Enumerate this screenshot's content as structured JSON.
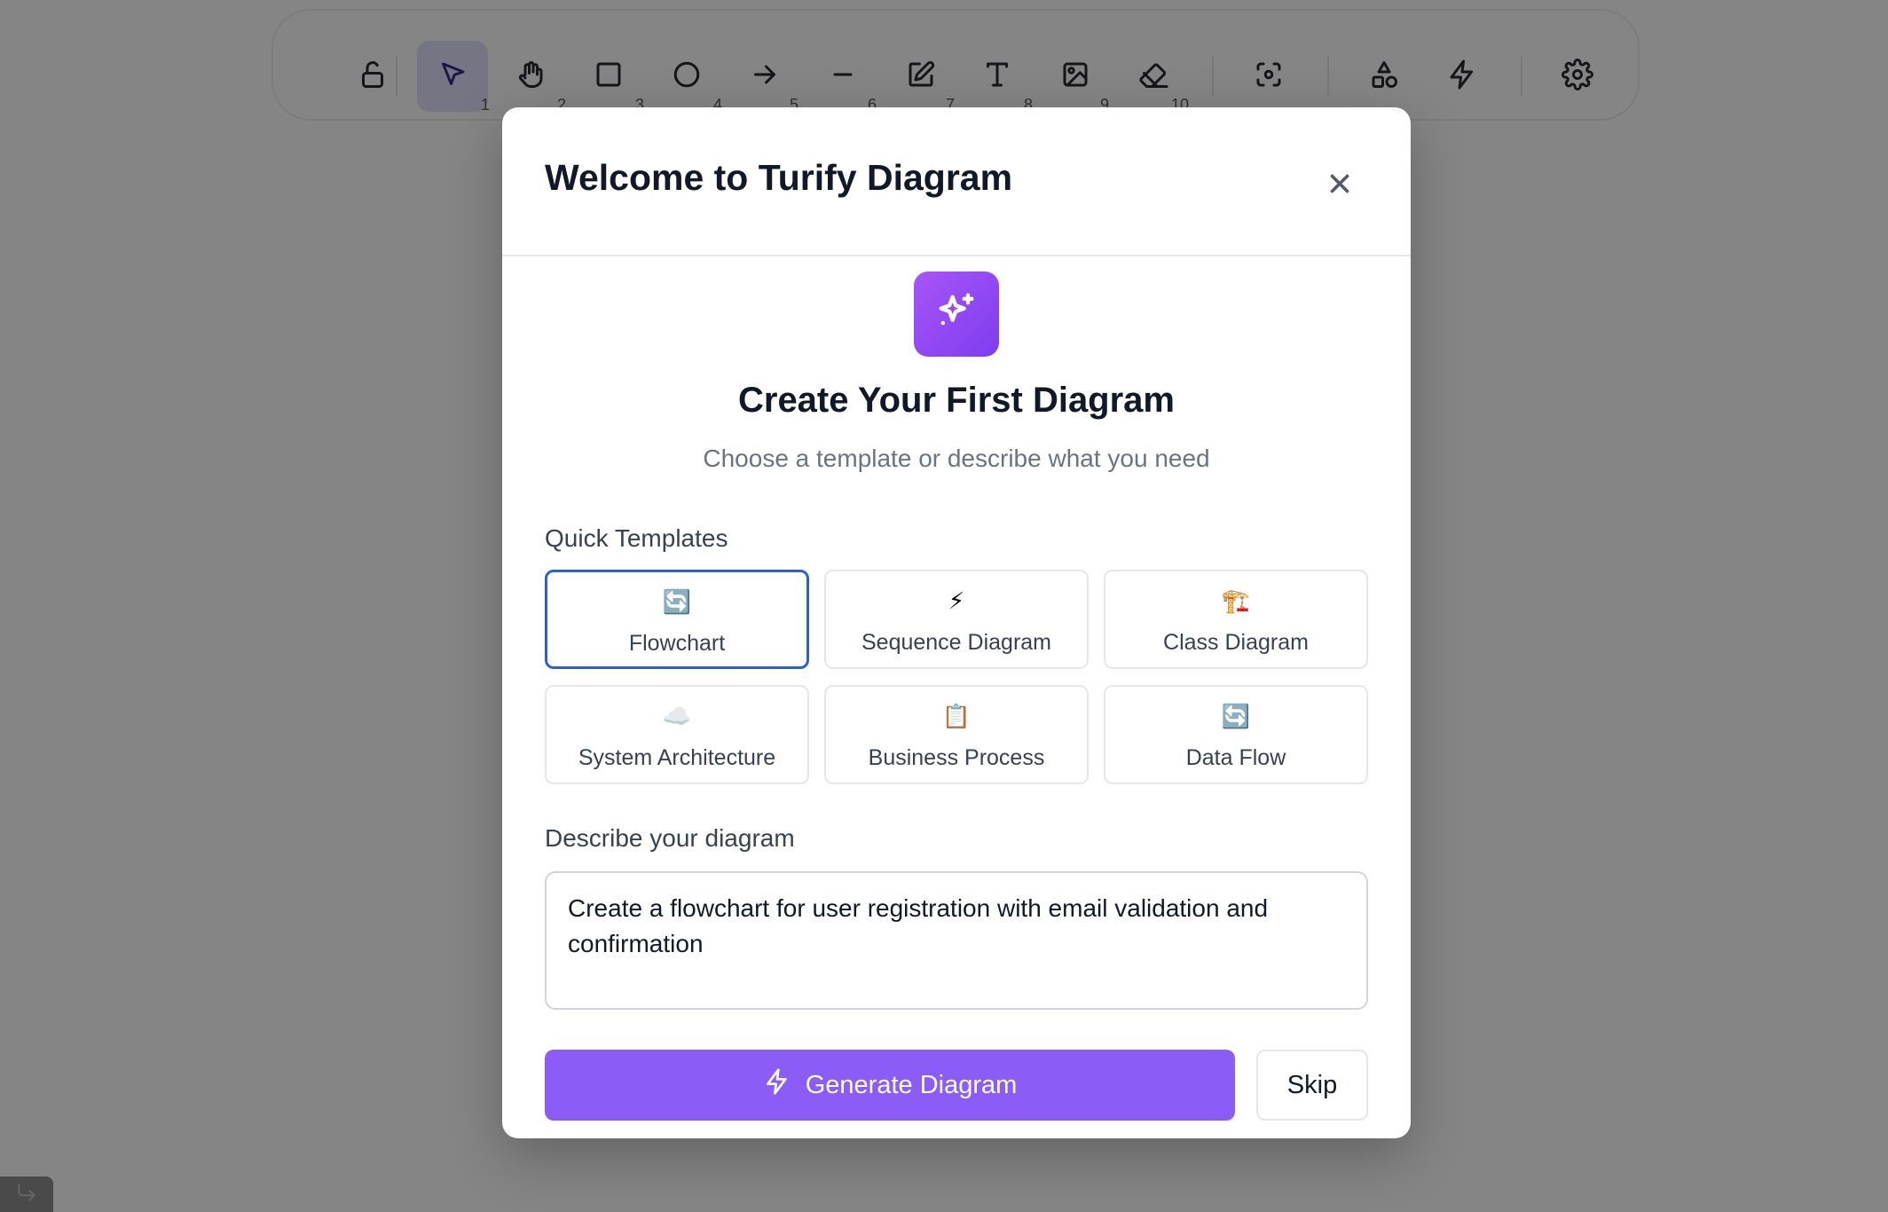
{
  "toolbar": {
    "tools": [
      {
        "name": "lock",
        "num": ""
      },
      {
        "name": "selection",
        "num": "1"
      },
      {
        "name": "hand",
        "num": "2"
      },
      {
        "name": "rectangle",
        "num": "3"
      },
      {
        "name": "ellipse",
        "num": "4"
      },
      {
        "name": "arrow",
        "num": "5"
      },
      {
        "name": "line",
        "num": "6"
      },
      {
        "name": "draw",
        "num": "7"
      },
      {
        "name": "text",
        "num": "8"
      },
      {
        "name": "image",
        "num": "9"
      },
      {
        "name": "eraser",
        "num": "10"
      },
      {
        "name": "frame",
        "num": ""
      },
      {
        "name": "shapes",
        "num": ""
      },
      {
        "name": "ai",
        "num": ""
      },
      {
        "name": "settings",
        "num": ""
      }
    ],
    "active_tool": "selection"
  },
  "modal": {
    "title": "Welcome to Turify Diagram",
    "hero_title": "Create Your First Diagram",
    "hero_subtitle": "Choose a template or describe what you need",
    "templates_label": "Quick Templates",
    "templates": [
      {
        "emoji": "🔄",
        "label": "Flowchart",
        "selected": true
      },
      {
        "emoji": "⚡",
        "label": "Sequence Diagram",
        "selected": false
      },
      {
        "emoji": "🏗️",
        "label": "Class Diagram",
        "selected": false
      },
      {
        "emoji": "☁️",
        "label": "System Architecture",
        "selected": false
      },
      {
        "emoji": "📋",
        "label": "Business Process",
        "selected": false
      },
      {
        "emoji": "🔄",
        "label": "Data Flow",
        "selected": false
      }
    ],
    "describe_label": "Describe your diagram",
    "describe_value": "Create a flowchart for user registration with email validation and confirmation",
    "generate_label": "Generate Diagram",
    "skip_label": "Skip"
  },
  "colors": {
    "accent": "#8b5cf6",
    "selected_border": "#2d5fd3",
    "active_tool_bg": "#e3e0fb"
  }
}
